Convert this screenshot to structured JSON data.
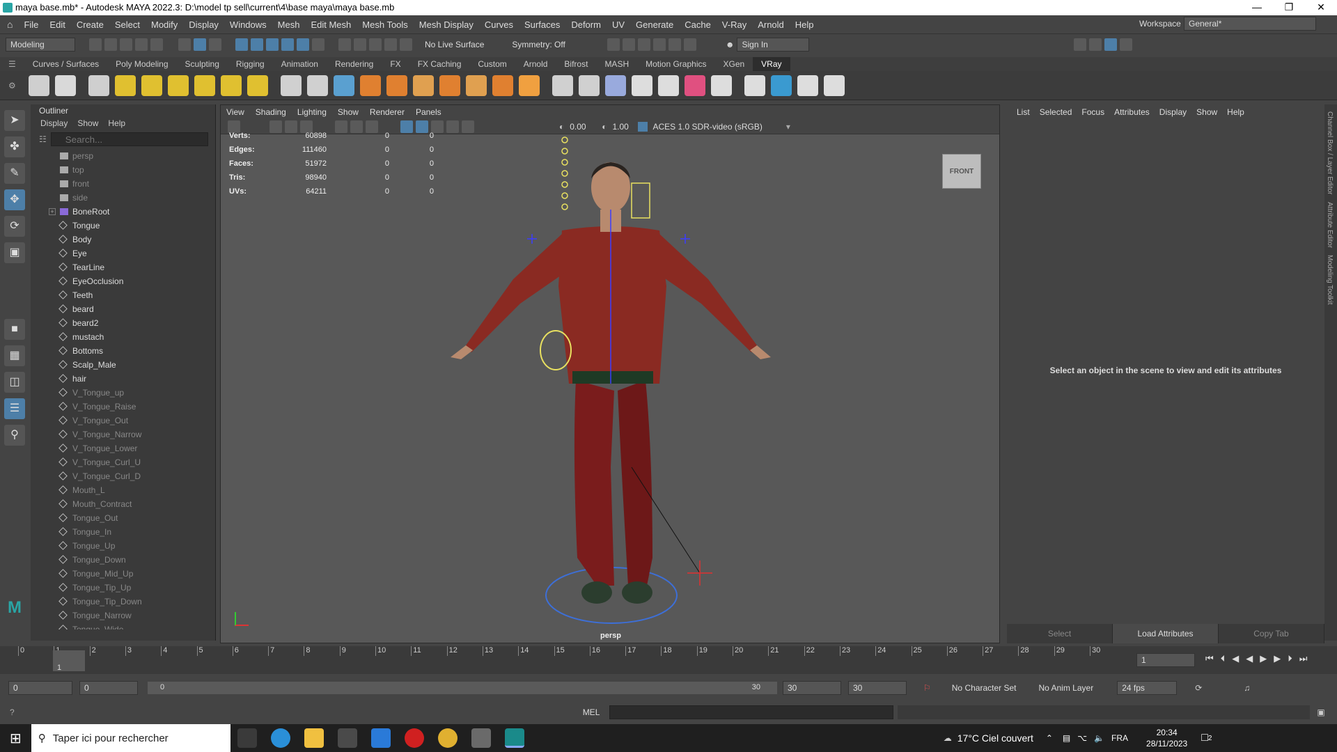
{
  "window": {
    "title": "maya base.mb* - Autodesk MAYA 2022.3: D:\\model tp sell\\current\\4\\base maya\\maya base.mb"
  },
  "menubar": {
    "items": [
      "File",
      "Edit",
      "Create",
      "Select",
      "Modify",
      "Display",
      "Windows",
      "Mesh",
      "Edit Mesh",
      "Mesh Tools",
      "Mesh Display",
      "Curves",
      "Surfaces",
      "Deform",
      "UV",
      "Generate",
      "Cache",
      "V-Ray",
      "Arnold",
      "Help"
    ],
    "workspace_label": "Workspace :",
    "workspace_value": "General*"
  },
  "statusline": {
    "mode": "Modeling",
    "live_surface": "No Live Surface",
    "symmetry": "Symmetry: Off",
    "sign_in": "Sign In"
  },
  "shelf_tabs": [
    "Curves / Surfaces",
    "Poly Modeling",
    "Sculpting",
    "Rigging",
    "Animation",
    "Rendering",
    "FX",
    "FX Caching",
    "Custom",
    "Arnold",
    "Bifrost",
    "MASH",
    "Motion Graphics",
    "XGen",
    "VRay"
  ],
  "shelf_active": "VRay",
  "shelf_icon_colors": [
    "#cfcfcf",
    "#d9d9d9",
    "#cfcfcf",
    "#e0c030",
    "#e0c030",
    "#e0c030",
    "#e0c030",
    "#e0c030",
    "#e0c030",
    "#d0d0d0",
    "#d0d0d0",
    "#5aa0d0",
    "#e08030",
    "#e08030",
    "#e0a050",
    "#e08030",
    "#e0a050",
    "#e08030",
    "#f0a040",
    "#d0d0d0",
    "#d0d0d0",
    "#9ad",
    "#ddd",
    "#ddd",
    "#e05080",
    "#ddd",
    "#ddd",
    "#3a9ad0",
    "#ddd",
    "#ddd"
  ],
  "outliner": {
    "title": "Outliner",
    "menu": [
      "Display",
      "Show",
      "Help"
    ],
    "search_placeholder": "Search...",
    "items": [
      {
        "label": "persp",
        "dim": true,
        "kind": "cam"
      },
      {
        "label": "top",
        "dim": true,
        "kind": "cam"
      },
      {
        "label": "front",
        "dim": true,
        "kind": "cam"
      },
      {
        "label": "side",
        "dim": true,
        "kind": "cam"
      },
      {
        "label": "BoneRoot",
        "dim": false,
        "kind": "joint",
        "expand": "+"
      },
      {
        "label": "Tongue",
        "dim": false,
        "kind": "mesh"
      },
      {
        "label": "Body",
        "dim": false,
        "kind": "mesh"
      },
      {
        "label": "Eye",
        "dim": false,
        "kind": "mesh"
      },
      {
        "label": "TearLine",
        "dim": false,
        "kind": "mesh"
      },
      {
        "label": "EyeOcclusion",
        "dim": false,
        "kind": "mesh"
      },
      {
        "label": "Teeth",
        "dim": false,
        "kind": "mesh"
      },
      {
        "label": "beard",
        "dim": false,
        "kind": "mesh"
      },
      {
        "label": "beard2",
        "dim": false,
        "kind": "mesh"
      },
      {
        "label": "mustach",
        "dim": false,
        "kind": "mesh"
      },
      {
        "label": "Bottoms",
        "dim": false,
        "kind": "mesh"
      },
      {
        "label": "Scalp_Male",
        "dim": false,
        "kind": "mesh"
      },
      {
        "label": "hair",
        "dim": false,
        "kind": "mesh"
      },
      {
        "label": "V_Tongue_up",
        "dim": true,
        "kind": "mesh"
      },
      {
        "label": "V_Tongue_Raise",
        "dim": true,
        "kind": "mesh"
      },
      {
        "label": "V_Tongue_Out",
        "dim": true,
        "kind": "mesh"
      },
      {
        "label": "V_Tongue_Narrow",
        "dim": true,
        "kind": "mesh"
      },
      {
        "label": "V_Tongue_Lower",
        "dim": true,
        "kind": "mesh"
      },
      {
        "label": "V_Tongue_Curl_U",
        "dim": true,
        "kind": "mesh"
      },
      {
        "label": "V_Tongue_Curl_D",
        "dim": true,
        "kind": "mesh"
      },
      {
        "label": "Mouth_L",
        "dim": true,
        "kind": "mesh"
      },
      {
        "label": "Mouth_Contract",
        "dim": true,
        "kind": "mesh"
      },
      {
        "label": "Tongue_Out",
        "dim": true,
        "kind": "mesh"
      },
      {
        "label": "Tongue_In",
        "dim": true,
        "kind": "mesh"
      },
      {
        "label": "Tongue_Up",
        "dim": true,
        "kind": "mesh"
      },
      {
        "label": "Tongue_Down",
        "dim": true,
        "kind": "mesh"
      },
      {
        "label": "Tongue_Mid_Up",
        "dim": true,
        "kind": "mesh"
      },
      {
        "label": "Tongue_Tip_Up",
        "dim": true,
        "kind": "mesh"
      },
      {
        "label": "Tongue_Tip_Down",
        "dim": true,
        "kind": "mesh"
      },
      {
        "label": "Tongue_Narrow",
        "dim": true,
        "kind": "mesh"
      },
      {
        "label": "Tongue_Wide",
        "dim": true,
        "kind": "mesh"
      }
    ]
  },
  "viewport": {
    "menu": [
      "View",
      "Shading",
      "Lighting",
      "Show",
      "Renderer",
      "Panels"
    ],
    "exposure": "0.00",
    "gamma": "1.00",
    "color_space": "ACES 1.0 SDR-video (sRGB)",
    "hud": [
      {
        "label": "Verts:",
        "v1": "60898",
        "v2": "0",
        "v3": "0"
      },
      {
        "label": "Edges:",
        "v1": "111460",
        "v2": "0",
        "v3": "0"
      },
      {
        "label": "Faces:",
        "v1": "51972",
        "v2": "0",
        "v3": "0"
      },
      {
        "label": "Tris:",
        "v1": "98940",
        "v2": "0",
        "v3": "0"
      },
      {
        "label": "UVs:",
        "v1": "64211",
        "v2": "0",
        "v3": "0"
      }
    ],
    "camera_label": "persp",
    "viewcube_label": "FRONT"
  },
  "attribute_editor": {
    "menu": [
      "List",
      "Selected",
      "Focus",
      "Attributes",
      "Display",
      "Show",
      "Help"
    ],
    "message": "Select an object in the scene to view and edit its attributes",
    "buttons": [
      "Select",
      "Load Attributes",
      "Copy Tab"
    ]
  },
  "right_strip": [
    "Channel Box / Layer Editor",
    "Attribute Editor",
    "Modeling Toolkit"
  ],
  "timeline": {
    "ticks": [
      "0",
      "1",
      "2",
      "3",
      "4",
      "5",
      "6",
      "7",
      "8",
      "9",
      "10",
      "11",
      "12",
      "13",
      "14",
      "15",
      "16",
      "17",
      "18",
      "19",
      "20",
      "21",
      "22",
      "23",
      "24",
      "25",
      "26",
      "27",
      "28",
      "29",
      "30"
    ],
    "current_frame_marker": "1",
    "current_frame_field": "1"
  },
  "range": {
    "start": "0",
    "anim_start": "0",
    "slider_start": "0",
    "slider_end": "30",
    "end": "30",
    "anim_end": "30",
    "character_set": "No Character Set",
    "anim_layer": "No Anim Layer",
    "fps": "24 fps"
  },
  "cmdline": {
    "lang": "MEL"
  },
  "taskbar": {
    "search_placeholder": "Taper ici pour rechercher",
    "weather": "17°C  Ciel couvert",
    "lang": "FRA",
    "time": "20:34",
    "date": "28/11/2023",
    "notif_count": "2"
  }
}
